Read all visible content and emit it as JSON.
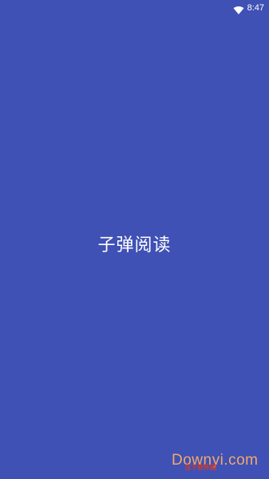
{
  "status_bar": {
    "time": "8:47",
    "wifi_icon": "wifi-icon"
  },
  "splash": {
    "title": "子弹阅读"
  },
  "watermark": {
    "text": "Downyi.com",
    "subtext": "当下软件园"
  },
  "colors": {
    "background": "#3f51b5",
    "text": "#ffffff",
    "watermark": "#f5a86a"
  }
}
